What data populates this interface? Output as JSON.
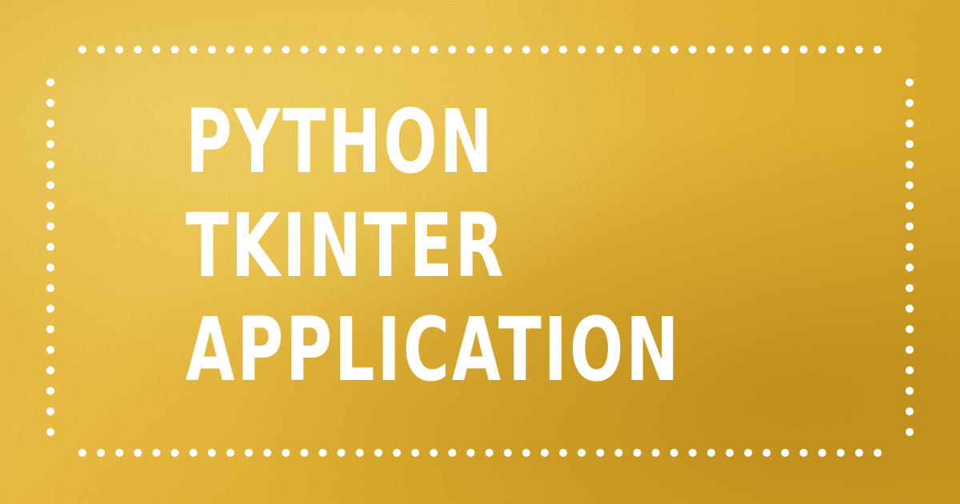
{
  "headline": {
    "lines": [
      "PYTHON",
      "TKINTER",
      "APPLICATION"
    ]
  },
  "colors": {
    "background_base": "#e6b43a",
    "background_light": "#f0c24a",
    "background_dark": "#d59f22",
    "text": "#ffffff",
    "dots": "#ffffff"
  }
}
